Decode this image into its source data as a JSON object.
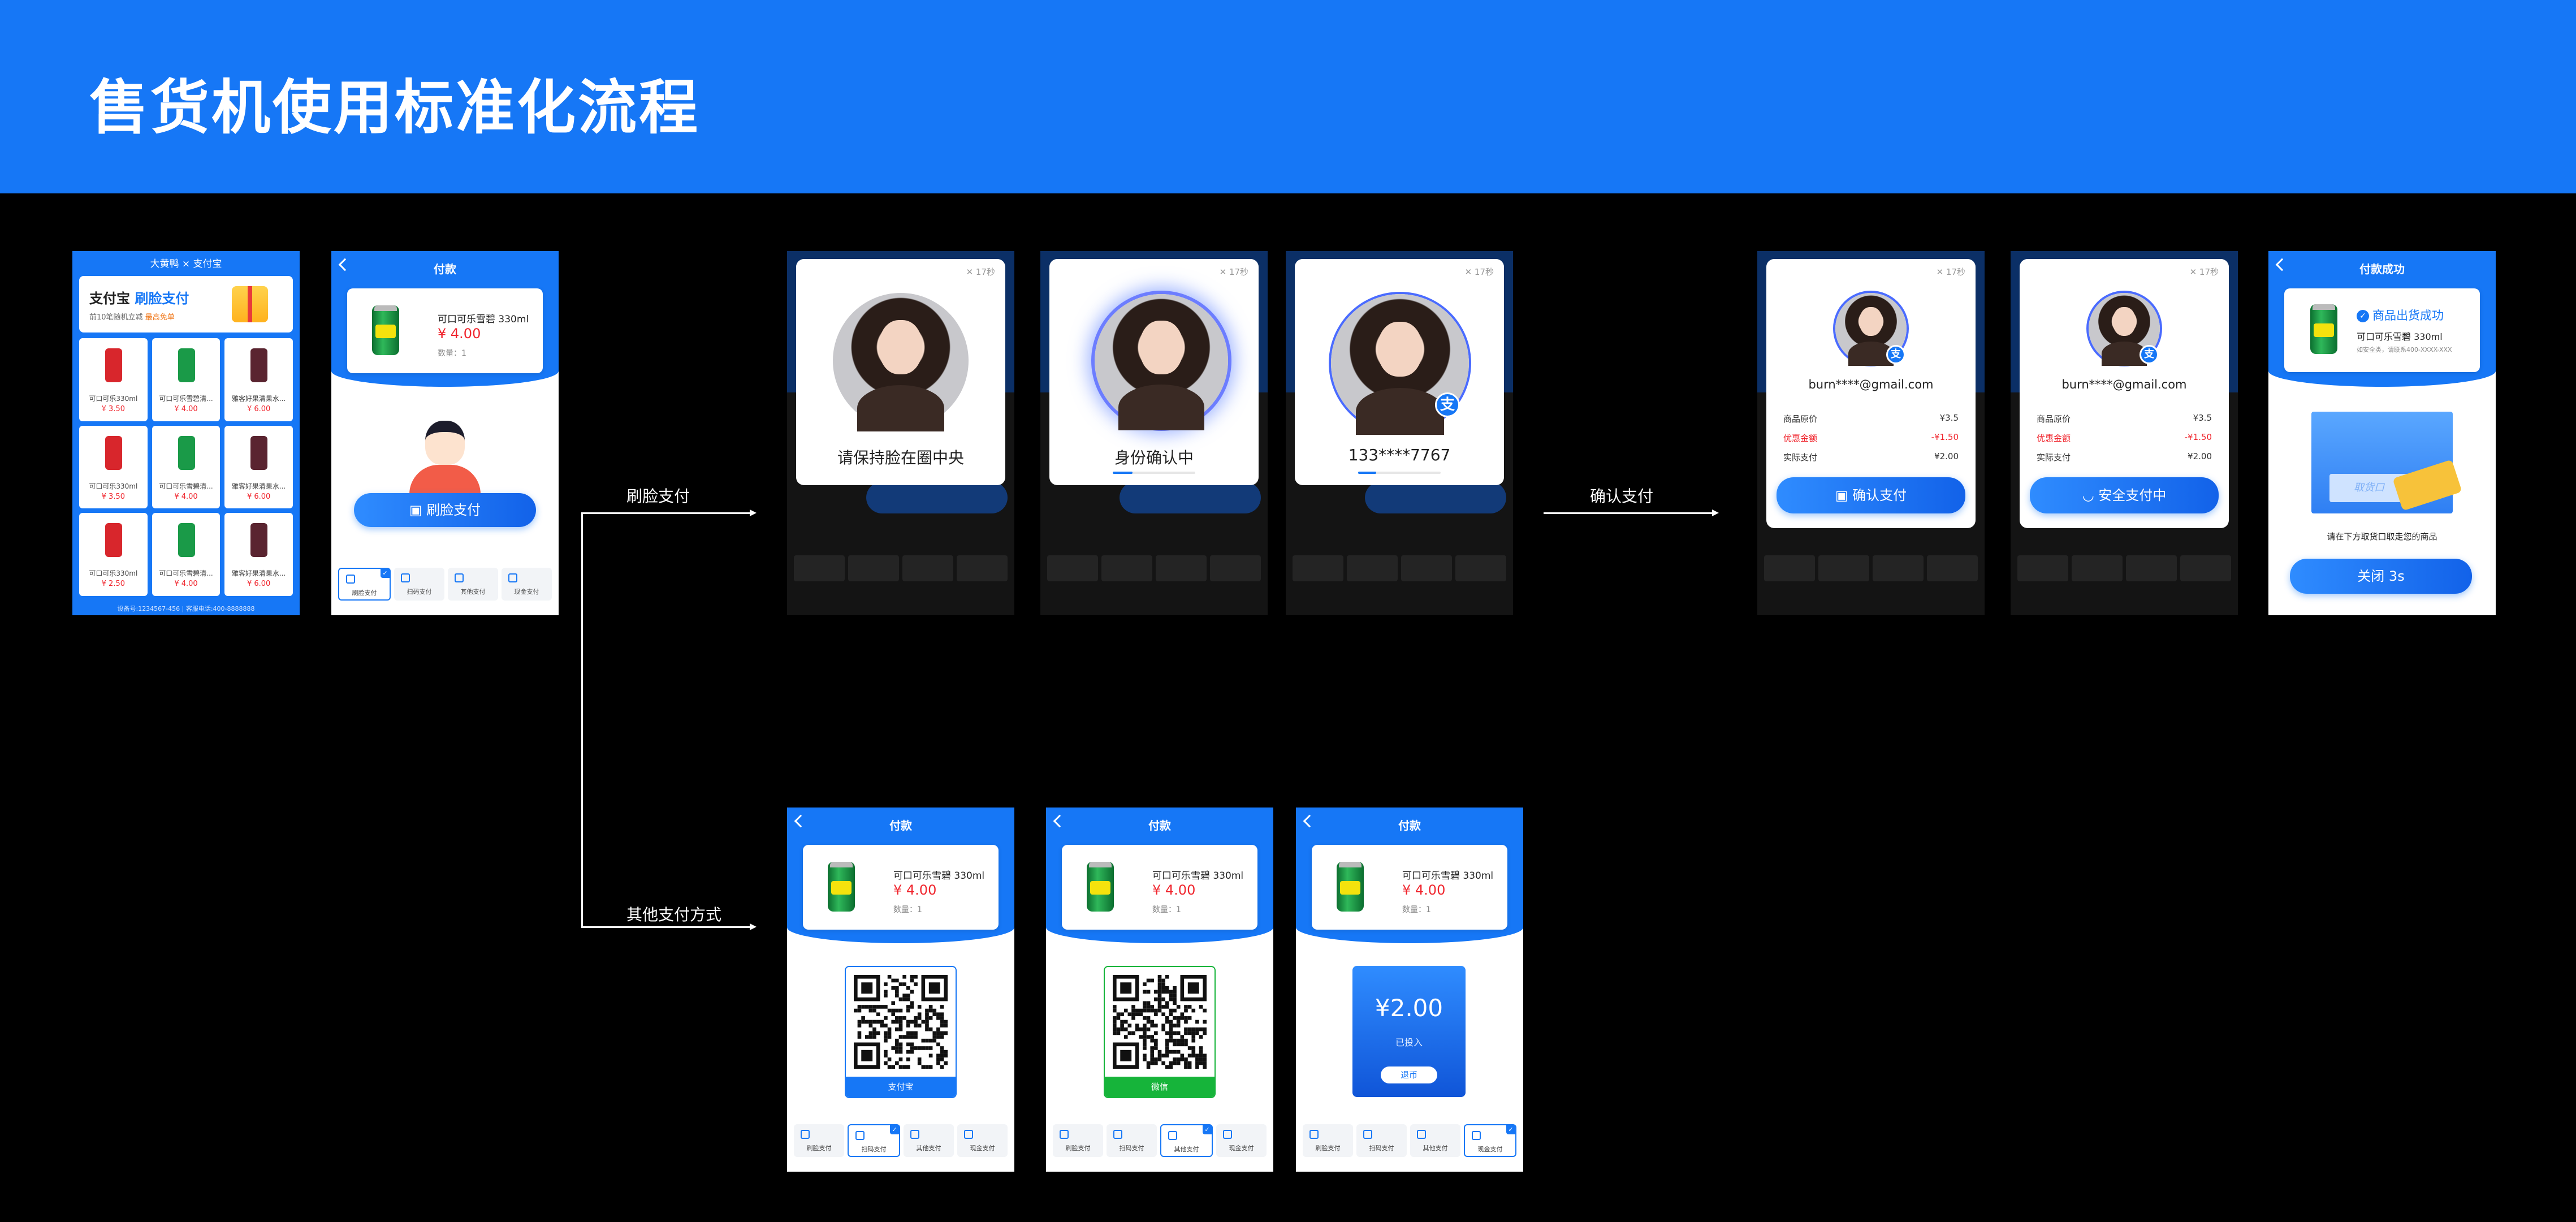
{
  "header": {
    "title": "售货机使用标准化流程"
  },
  "flow": {
    "face_pay": "刷脸支付",
    "confirm_pay": "确认支付",
    "other_pay": "其他支付方式"
  },
  "vending": {
    "brand": "大黄鸭  ×  支付宝",
    "promo_prefix": "支付宝",
    "promo_highlight": "刷脸支付",
    "promo_sub_prefix": "前10笔随机立减",
    "promo_sub_highlight": "最高免单",
    "items": [
      {
        "name": "可口可乐330ml",
        "price": "¥ 3.50",
        "color": "#d8262c"
      },
      {
        "name": "可口可乐雪碧清...",
        "price": "¥ 4.00",
        "color": "#1a9a48"
      },
      {
        "name": "雅客好果清果水...",
        "price": "¥ 6.00",
        "color": "#5a2430"
      },
      {
        "name": "可口可乐330ml",
        "price": "¥ 3.50",
        "color": "#d8262c"
      },
      {
        "name": "可口可乐雪碧清...",
        "price": "¥ 4.00",
        "color": "#1a9a48"
      },
      {
        "name": "雅客好果清果水...",
        "price": "¥ 6.00",
        "color": "#5a2430"
      },
      {
        "name": "可口可乐330ml",
        "price": "¥ 2.50",
        "color": "#d8262c"
      },
      {
        "name": "可口可乐雪碧清...",
        "price": "¥ 4.00",
        "color": "#1a9a48"
      },
      {
        "name": "雅客好果清果水...",
        "price": "¥ 6.00",
        "color": "#5a2430"
      }
    ],
    "footer": "设备号:1234567-456  |  客服电话:400-8888888"
  },
  "payment": {
    "title": "付款",
    "product_name": "可口可乐雪碧 330ml",
    "price": "¥ 4.00",
    "qty": "数量：1",
    "face_button": "刷脸支付",
    "tabs": [
      "刷脸支付",
      "扫码支付",
      "其他支付",
      "现金支付"
    ],
    "check": "✓"
  },
  "face": {
    "close": "✕ 17秒",
    "step1_text": "请保持脸在圈中央",
    "step2_text": "身份确认中",
    "step3_text": "133****7767",
    "alipay_glyph": "支"
  },
  "confirm": {
    "email": "burn****@gmail.com",
    "rows": [
      {
        "label": "商品原价",
        "value": "¥3.5"
      },
      {
        "label": "优惠金额",
        "value": "-¥1.50"
      },
      {
        "label": "实际支付",
        "value": "¥2.00"
      }
    ],
    "confirm_button": "确认支付",
    "paying_button": "安全支付中"
  },
  "success": {
    "title": "付款成功",
    "headline": "商品出货成功",
    "product_name": "可口可乐雪碧 330ml",
    "note": "如安全类，请联系400-XXXX-XXX",
    "window_text": "取货口",
    "hint": "请在下方取货口取走您的商品",
    "close_button": "关闭 3s"
  },
  "other": {
    "alipay_label": "支付宝",
    "wechat_label": "微信",
    "cash_amount": "¥2.00",
    "cash_sub": "已投入",
    "cash_button": "退币"
  }
}
